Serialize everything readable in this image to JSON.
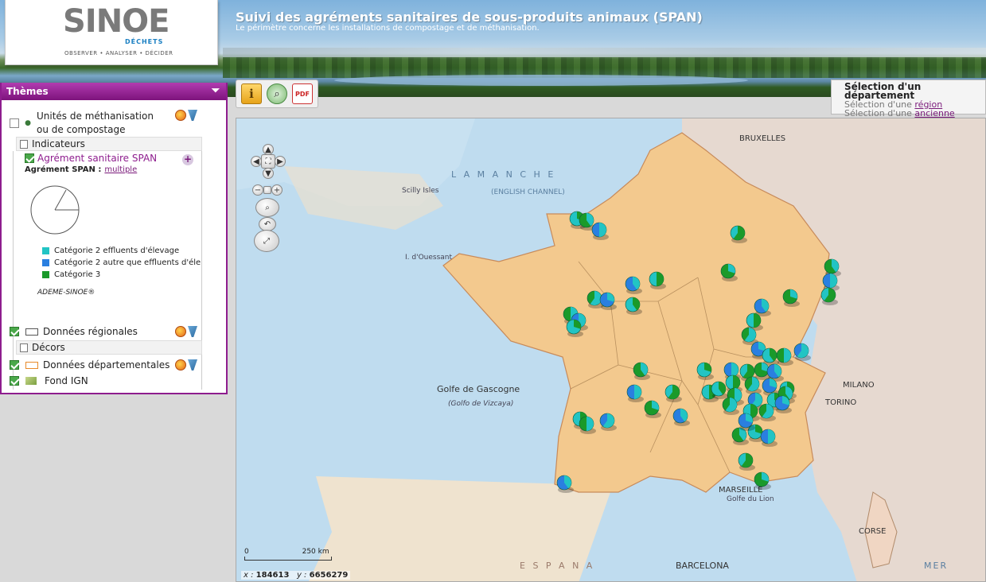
{
  "header": {
    "logo": "SINOE",
    "logo_sub": "DÉCHETS",
    "logo_tagline": "OBSERVER • ANALYSER • DÉCIDER",
    "title": "Suivi des agréments sanitaires de sous-produits animaux (SPAN)",
    "subtitle": "Le périmètre concerne les installations de compostage et de méthanisation."
  },
  "themes": {
    "title": "Thèmes",
    "layers": {
      "unites": "Unités de méthanisation ou de compostage",
      "regionales": "Données régionales",
      "departementales": "Données départementales",
      "fond": "Fond IGN"
    },
    "indicateurs_label": "Indicateurs",
    "decors_label": "Décors",
    "indicator_name": "Agrément sanitaire SPAN",
    "indicator_field_label": "Agrément SPAN :",
    "indicator_field_value": "multiple",
    "legend": [
      {
        "label": "Catégorie 2 effluents d'élevage",
        "color": "#22c4c4"
      },
      {
        "label": "Catégorie 2 autre que effluents d'éle",
        "color": "#2a7fe0"
      },
      {
        "label": "Catégorie 3",
        "color": "#1a9a2a"
      }
    ],
    "credit": "ADEME-SINOE®"
  },
  "selection": {
    "title": "Sélection d'un département",
    "region_prefix": "Sélection d'une",
    "region_link": "région",
    "old_region_prefix": "Sélection d'une",
    "old_region_link": "ancienne région"
  },
  "map": {
    "places": {
      "manche": "L A   M A N C H E",
      "channel": "(ENGLISH CHANNEL)",
      "gascogne": "Golfe de Gascogne",
      "vizcaya": "(Golfo de Vizcaya)",
      "marseille": "MARSEILLE",
      "barcelona": "BARCELONA",
      "milano": "MILANO",
      "torino": "TORINO",
      "bruxelles": "BRUXELLES",
      "corse": "CORSE",
      "mer": "MER",
      "espana": "E S P A N A",
      "lion": "Golfe du Lion",
      "ouessant": "I. d'Ouessant",
      "scilly": "Scilly Isles"
    },
    "scale_zero": "0",
    "scale_label": "250 km",
    "coord_x_label": "x :",
    "coord_x": "184613",
    "coord_y_label": "y :",
    "coord_y": "6656279"
  },
  "colors": {
    "accent": "#8e1d8e",
    "cat2_elevage": "#22c4c4",
    "cat2_autre": "#2a7fe0",
    "cat3": "#1a9a2a",
    "land_fr": "#f3c98e",
    "sea": "#bfdcef"
  }
}
